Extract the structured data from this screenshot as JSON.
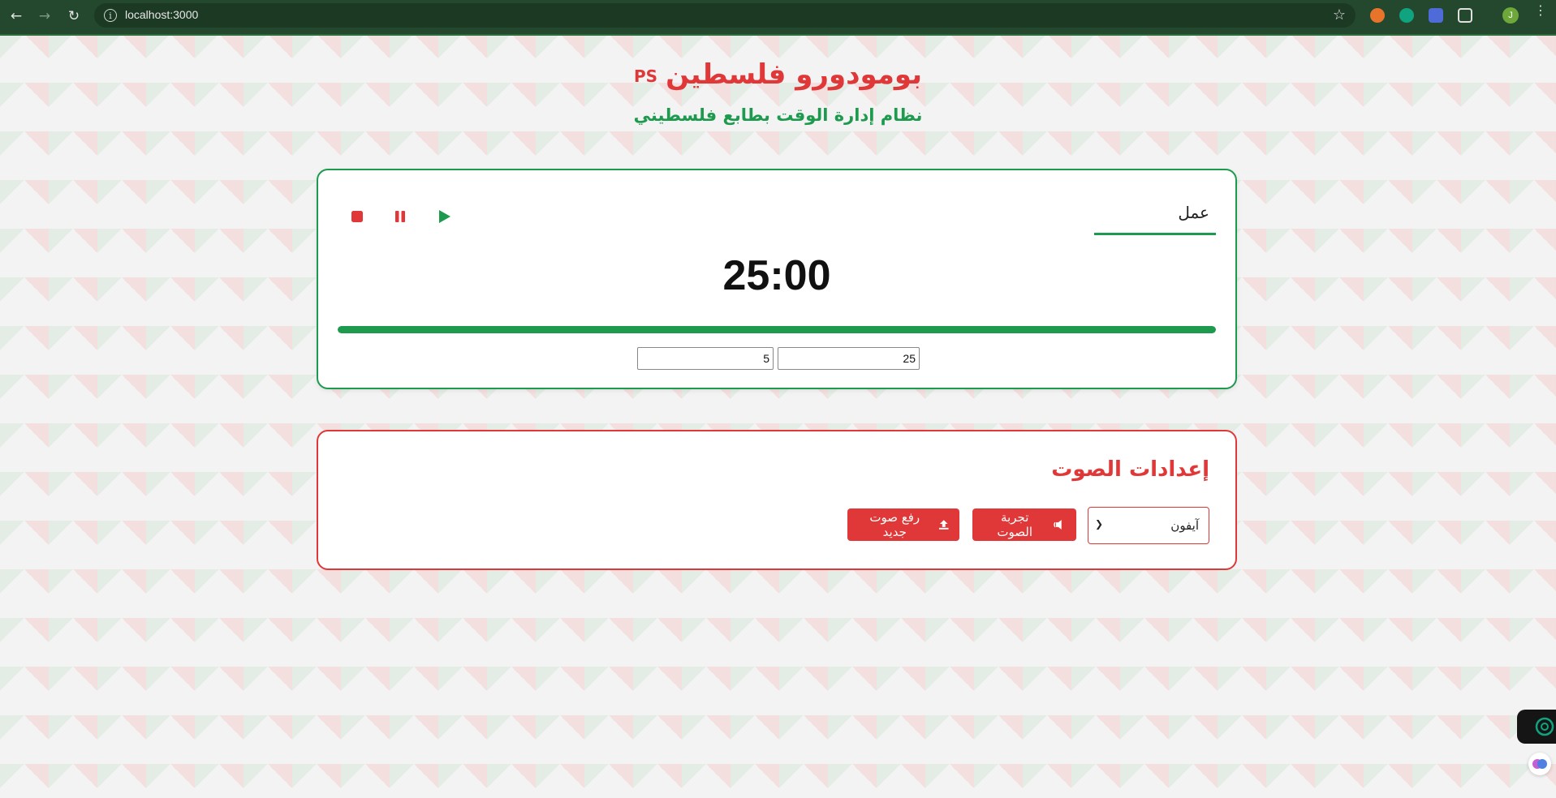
{
  "browser": {
    "url": "localhost:3000"
  },
  "header": {
    "title": "بومودورو فلسطين",
    "title_badge": "PS",
    "subtitle": "نظام إدارة الوقت بطابع فلسطيني"
  },
  "timer": {
    "mode_label": "عمل",
    "display": "25:00",
    "progress_fraction": 1.0,
    "work_minutes": "25",
    "break_minutes": "5",
    "controls": [
      "play-icon",
      "pause-icon",
      "stop-icon"
    ]
  },
  "sound_settings": {
    "title": "إعدادات الصوت",
    "selected_sound": "آيفون",
    "test_button": "تجربة الصوت",
    "upload_button": "رفع صوت جديد",
    "icons": [
      "volume-icon",
      "upload-icon"
    ]
  },
  "colors": {
    "brand_red": "#e03838",
    "brand_green": "#1d9a4e",
    "chrome_green": "#23482d"
  }
}
